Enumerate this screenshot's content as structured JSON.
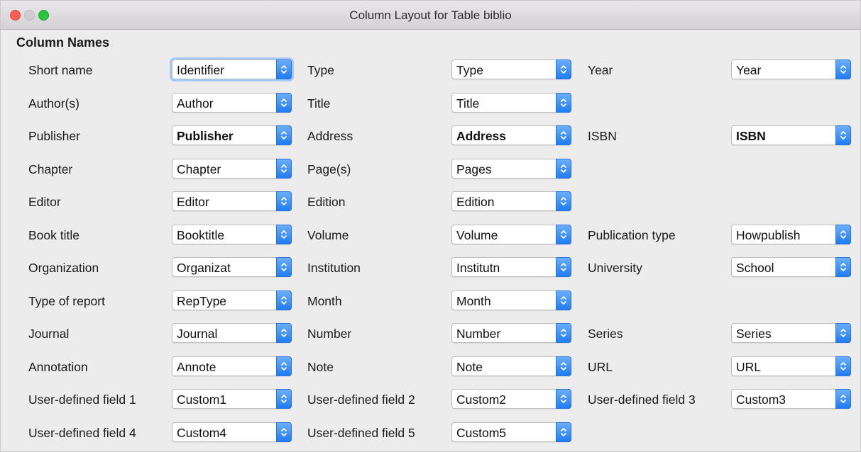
{
  "window": {
    "title": "Column Layout for Table biblio"
  },
  "section_title": "Column Names",
  "rows": [
    [
      {
        "label": "Short name",
        "value": "Identifier"
      },
      {
        "label": "Type",
        "value": "Type"
      },
      {
        "label": "Year",
        "value": "Year"
      }
    ],
    [
      {
        "label": "Author(s)",
        "value": "Author"
      },
      {
        "label": "Title",
        "value": "Title"
      },
      null
    ],
    [
      {
        "label": "Publisher",
        "value": "Publisher"
      },
      {
        "label": "Address",
        "value": "Address"
      },
      {
        "label": "ISBN",
        "value": "ISBN"
      }
    ],
    [
      {
        "label": "Chapter",
        "value": "Chapter"
      },
      {
        "label": "Page(s)",
        "value": "Pages"
      },
      null
    ],
    [
      {
        "label": "Editor",
        "value": "Editor"
      },
      {
        "label": "Edition",
        "value": "Edition"
      },
      null
    ],
    [
      {
        "label": "Book title",
        "value": "Booktitle"
      },
      {
        "label": "Volume",
        "value": "Volume"
      },
      {
        "label": "Publication type",
        "value": "Howpublish"
      }
    ],
    [
      {
        "label": "Organization",
        "value": "Organizat"
      },
      {
        "label": "Institution",
        "value": "Institutn"
      },
      {
        "label": "University",
        "value": "School"
      }
    ],
    [
      {
        "label": "Type of report",
        "value": "RepType"
      },
      {
        "label": "Month",
        "value": "Month"
      },
      null
    ],
    [
      {
        "label": "Journal",
        "value": "Journal"
      },
      {
        "label": "Number",
        "value": "Number"
      },
      {
        "label": "Series",
        "value": "Series"
      }
    ],
    [
      {
        "label": "Annotation",
        "value": "Annote"
      },
      {
        "label": "Note",
        "value": "Note"
      },
      {
        "label": "URL",
        "value": "URL"
      }
    ],
    [
      {
        "label": "User-defined field 1",
        "value": "Custom1"
      },
      {
        "label": "User-defined field 2",
        "value": "Custom2"
      },
      {
        "label": "User-defined field 3",
        "value": "Custom3"
      }
    ],
    [
      {
        "label": "User-defined field 4",
        "value": "Custom4"
      },
      {
        "label": "User-defined field 5",
        "value": "Custom5"
      },
      null
    ]
  ],
  "colors": {
    "accent": "#1f7cf3",
    "close": "#fc5f57",
    "maximize": "#2ac63f"
  }
}
